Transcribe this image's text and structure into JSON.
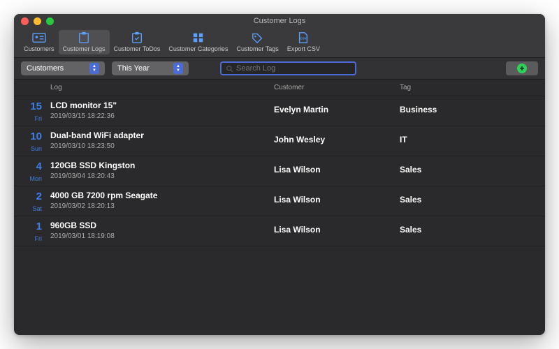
{
  "window": {
    "title": "Customer Logs"
  },
  "toolbar": {
    "items": [
      {
        "label": "Customers"
      },
      {
        "label": "Customer Logs"
      },
      {
        "label": "Customer ToDos"
      },
      {
        "label": "Customer Categories"
      },
      {
        "label": "Customer Tags"
      },
      {
        "label": "Export CSV"
      }
    ],
    "active_index": 1
  },
  "filters": {
    "dropdown1": "Customers",
    "dropdown2": "This Year",
    "search_placeholder": "Search Log"
  },
  "columns": {
    "log": "Log",
    "customer": "Customer",
    "tag": "Tag"
  },
  "entries": [
    {
      "day_num": "15",
      "day_abbr": "Fri",
      "title": "LCD monitor 15\"",
      "timestamp": "2019/03/15 18:22:36",
      "customer": "Evelyn Martin",
      "tag": "Business"
    },
    {
      "day_num": "10",
      "day_abbr": "Sun",
      "title": "Dual-band WiFi adapter",
      "timestamp": "2019/03/10 18:23:50",
      "customer": "John Wesley",
      "tag": "IT"
    },
    {
      "day_num": "4",
      "day_abbr": "Mon",
      "title": "120GB SSD Kingston",
      "timestamp": "2019/03/04 18:20:43",
      "customer": "Lisa Wilson",
      "tag": "Sales"
    },
    {
      "day_num": "2",
      "day_abbr": "Sat",
      "title": "4000 GB 7200 rpm Seagate",
      "timestamp": "2019/03/02 18:20:13",
      "customer": "Lisa Wilson",
      "tag": "Sales"
    },
    {
      "day_num": "1",
      "day_abbr": "Fri",
      "title": "960GB SSD",
      "timestamp": "2019/03/01 18:19:08",
      "customer": "Lisa Wilson",
      "tag": "Sales"
    }
  ],
  "colors": {
    "accent_blue": "#3f7fe8",
    "add_green": "#30d158"
  }
}
